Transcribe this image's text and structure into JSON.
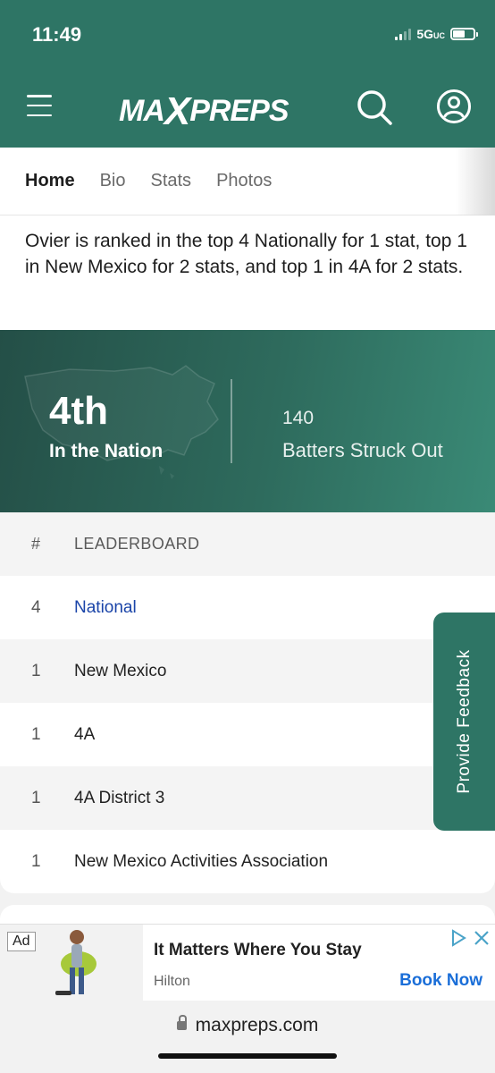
{
  "status_bar": {
    "time": "11:49",
    "network": "5G",
    "network_suffix": "UC"
  },
  "header": {
    "logo_text_left": "MA",
    "logo_text_x": "X",
    "logo_text_right": "PREPS",
    "icons": [
      "menu-icon",
      "search-icon",
      "profile-icon"
    ]
  },
  "tabs": [
    {
      "label": "Home",
      "active": true
    },
    {
      "label": "Bio",
      "active": false
    },
    {
      "label": "Stats",
      "active": false
    },
    {
      "label": "Photos",
      "active": false
    }
  ],
  "summary": "Ovier is ranked in the top 4 Nationally for 1 stat, top 1 in New Mexico for 2 stats, and top 1 in 4A for 2 stats.",
  "banner": {
    "rank": "4th",
    "rank_label": "In the Nation",
    "stat_value": "140",
    "stat_name": "Batters Struck Out"
  },
  "leaderboard": {
    "header_num": "#",
    "header_label": "LEADERBOARD",
    "rows": [
      {
        "num": "4",
        "label": "National",
        "link": true
      },
      {
        "num": "1",
        "label": "New Mexico",
        "link": false
      },
      {
        "num": "1",
        "label": "4A",
        "link": false
      },
      {
        "num": "1",
        "label": "4A District 3",
        "link": false
      },
      {
        "num": "1",
        "label": "New Mexico Activities Association",
        "link": false
      }
    ]
  },
  "feedback_label": "Provide Feedback",
  "ad": {
    "badge": "Ad",
    "title": "It Matters Where You Stay",
    "brand": "Hilton",
    "cta": "Book Now"
  },
  "browser": {
    "url": "maxpreps.com"
  },
  "colors": {
    "brand_green": "#2e7565",
    "link_blue": "#1a44a8",
    "cta_blue": "#1a6ed8"
  }
}
